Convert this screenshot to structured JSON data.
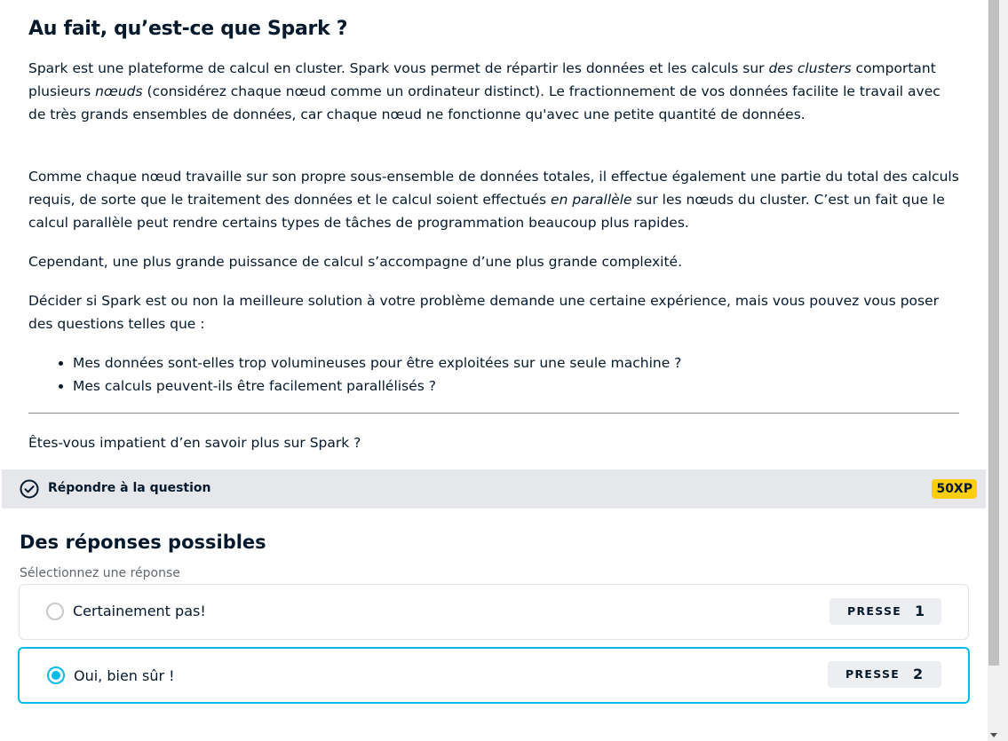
{
  "article": {
    "title": "Au fait, qu’est-ce que Spark ?",
    "p1": {
      "a": "Spark est une plateforme de calcul en cluster. Spark vous permet de répartir les données et les calculs sur ",
      "b": "des clusters",
      "c": " comportant plusieurs ",
      "d": "nœuds",
      "e": " (considérez chaque nœud comme un ordinateur distinct). Le fractionnement de vos données facilite le travail avec de très grands ensembles de données, car chaque nœud ne fonctionne qu'avec une petite quantité de données."
    },
    "p2": {
      "a": "Comme chaque nœud travaille sur son propre sous-ensemble de données totales, il effectue également une partie du total des calculs requis, de sorte que le traitement des données et le calcul soient effectués ",
      "b": "en parallèle",
      "c": " sur les nœuds du cluster. C’est un fait que le calcul parallèle peut rendre certains types de tâches de programmation beaucoup plus rapides."
    },
    "p3": "Cependant, une plus grande puissance de calcul s’accompagne d’une plus grande complexité.",
    "p4": "Décider si Spark est ou non la meilleure solution à votre problème demande une certaine expérience, mais vous pouvez vous poser des questions telles que :",
    "bullets": [
      "Mes données sont-elles trop volumineuses pour être exploitées sur une seule machine ?",
      "Mes calculs peuvent-ils être facilement parallélisés ?"
    ],
    "question": "Êtes-vous impatient d’en savoir plus sur Spark ?"
  },
  "answer_bar": {
    "icon": "check-circle-icon",
    "label": "Répondre à la question",
    "xp": "50XP"
  },
  "options": {
    "title": "Des réponses possibles",
    "subtitle": "Sélectionnez une réponse",
    "items": [
      {
        "label": "Certainement pas!",
        "key_word": "PRESSE",
        "key": "1",
        "selected": false
      },
      {
        "label": "Oui, bien sûr !",
        "key_word": "PRESSE",
        "key": "2",
        "selected": true
      }
    ]
  },
  "colors": {
    "text": "#05192d",
    "accent": "#03bce8",
    "xp_badge": "#fcce0d",
    "bar_bg": "#e5e7ea"
  }
}
